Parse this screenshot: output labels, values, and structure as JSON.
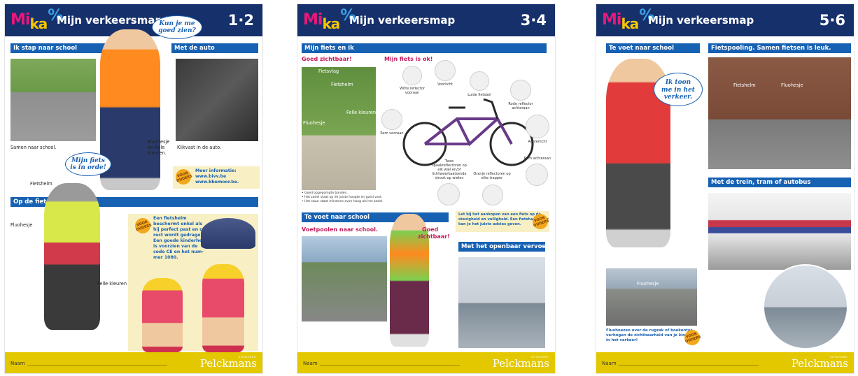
{
  "common": {
    "logo_mi": "Mi",
    "logo_ka": "ka",
    "logo_pct": "%",
    "title": "Mijn verkeersmap",
    "naam": "Naam",
    "publisher": "Pelckmans",
    "publisher_sub": "UITGEVERIJ",
    "ouders_badge": "VOOR OUDERS"
  },
  "page1": {
    "number": "1·2",
    "bubble_top": "Kun je me goed zien?",
    "bubble_bike": "Mijn fiets is in orde!",
    "sections": {
      "school": "Ik stap naar school",
      "auto": "Met de auto",
      "fiets": "Op de fiets"
    },
    "captions": {
      "samen": "Samen naar school.",
      "klikvast": "Klikvast in de auto.",
      "fluohesje_felle_1": "Fluohesje",
      "fluohesje_felle_2": "en felle",
      "fluohesje_felle_3": "kleuren.",
      "fietshelm": "Fietshelm",
      "fluohesje": "Fluohesje",
      "felle_kleuren": "Felle kleuren"
    },
    "info": {
      "line1": "Meer informatie:",
      "line2": "www.bivv.be",
      "line3": "www.kbemoor.be."
    },
    "helmet_info": [
      "Een fietshelm",
      "beschermt enkel als",
      "hij perfect past en cor-",
      "rect wordt gedragen.",
      "Een goede kinderhelm",
      "is voorzien van de",
      "code CE en het num-",
      "mer 1080."
    ]
  },
  "page2": {
    "number": "3·4",
    "sections": {
      "fiets_en_ik": "Mijn fiets en ik",
      "te_voet": "Te voet naar school",
      "openbaar": "Met het openbaar vervoer"
    },
    "subheads": {
      "zichtbaar": "Goed zichtbaar!",
      "fiets_ok": "Mijn fiets is ok!",
      "voetpoolen": "Voetpoolen naar school.",
      "goed_zichtbaar_1": "Goed",
      "goed_zichtbaar_2": "zichtbaar!"
    },
    "photo_labels": {
      "fietsvlag": "Fietsvlag",
      "fietshelm": "Fietshelm",
      "felle_kleuren": "Felle kleuren",
      "fluohesje": "Fluohesje"
    },
    "parts": {
      "witte_reflector": "Witte reflector vooraan",
      "voorlicht": "Voorlicht",
      "luide_fietsbel": "Luide fietsbel",
      "rode_reflector": "Rode reflector achteraan",
      "rem_vooraan": "Rem vooraan",
      "achterlicht": "Achterlicht",
      "rem_achteraan": "Rem achteraan",
      "spaakreflectoren": "Twee spaakreflectoren op elk wiel en/of lichtweerkaatsende strook op wielen",
      "oranje_reflectoren": "Oranje reflectoren op elke trapper"
    },
    "bullets": [
      "• Goed opgepompte banden.",
      "• Het zadel staat op de juiste hoogte en goed vast.",
      "• Het stuur staat minstens even hoog als het zadel."
    ],
    "advice": [
      "Let bij het aankopen van een fiets op de",
      "stevigheid en veiligheid. Een fietshandelaar",
      "kan je het juiste advies geven."
    ]
  },
  "page3": {
    "number": "5·6",
    "sections": {
      "te_voet": "Te voet naar school",
      "fietspooling": "Fietspooling. Samen fietsen is leuk.",
      "trein": "Met de trein, tram of autobus"
    },
    "bubble": "Ik toon me in het verkeer.",
    "photo_labels": {
      "fietshelm": "Fietshelm",
      "fluohesje_photo": "Fluohesje",
      "fluohesje_road": "Fluohesje"
    },
    "caption_lines": [
      "Fluohoezen over de rugzak of boekentas",
      "verhogen de zichtbaarheid van je kind",
      "in het verkeer!"
    ]
  }
}
